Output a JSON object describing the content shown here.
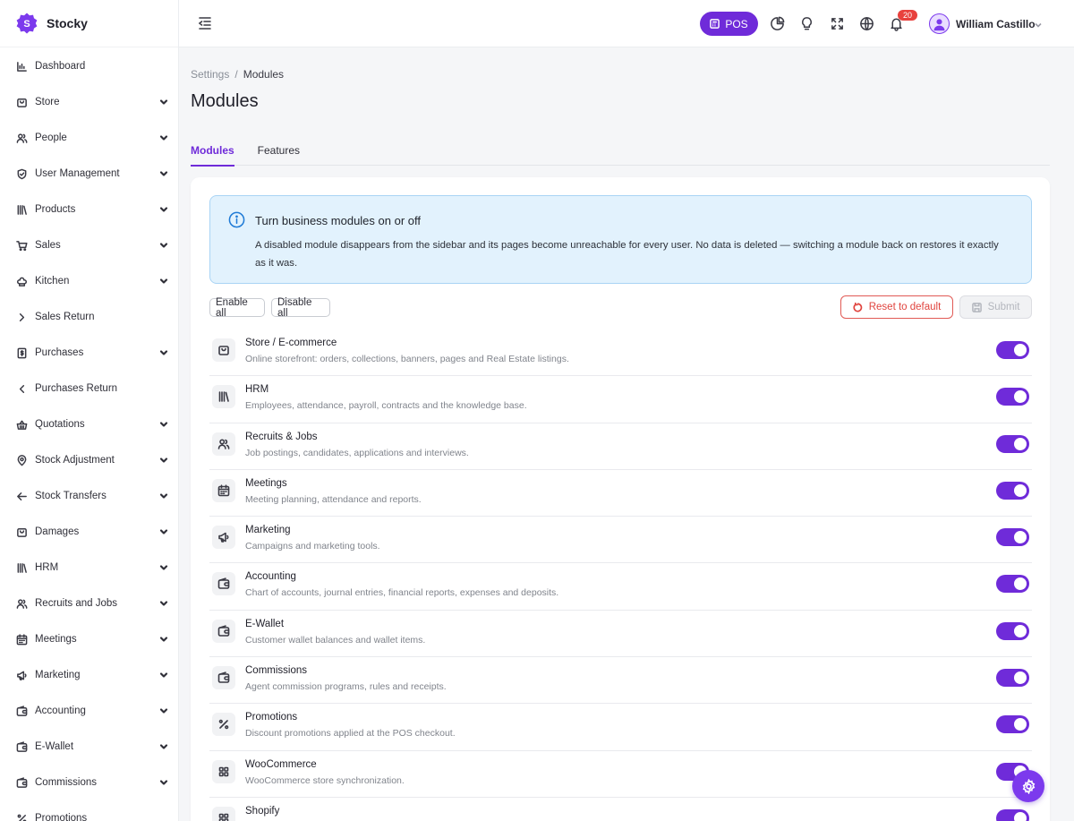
{
  "brand": {
    "name": "Stocky",
    "logo_letter": "S"
  },
  "sidebar": {
    "items": [
      {
        "label": "Dashboard",
        "icon": "chart-bar-icon",
        "chevron": "none"
      },
      {
        "label": "Store",
        "icon": "bag-icon",
        "chevron": "down"
      },
      {
        "label": "People",
        "icon": "users-icon",
        "chevron": "down"
      },
      {
        "label": "User Management",
        "icon": "shield-icon",
        "chevron": "down"
      },
      {
        "label": "Products",
        "icon": "library-icon",
        "chevron": "down"
      },
      {
        "label": "Sales",
        "icon": "cart-icon",
        "chevron": "down"
      },
      {
        "label": "Kitchen",
        "icon": "chef-hat-icon",
        "chevron": "down"
      },
      {
        "label": "Sales Return",
        "icon": "chevron-right-icon",
        "chevron": "none"
      },
      {
        "label": "Purchases",
        "icon": "invoice-icon",
        "chevron": "down"
      },
      {
        "label": "Purchases Return",
        "icon": "chevron-left-icon",
        "chevron": "none"
      },
      {
        "label": "Quotations",
        "icon": "basket-icon",
        "chevron": "down"
      },
      {
        "label": "Stock Adjustment",
        "icon": "map-pin-icon",
        "chevron": "down"
      },
      {
        "label": "Stock Transfers",
        "icon": "arrow-left-icon",
        "chevron": "down"
      },
      {
        "label": "Damages",
        "icon": "bag-icon",
        "chevron": "down"
      },
      {
        "label": "HRM",
        "icon": "library-icon",
        "chevron": "down"
      },
      {
        "label": "Recruits and Jobs",
        "icon": "users-icon",
        "chevron": "down"
      },
      {
        "label": "Meetings",
        "icon": "calendar-icon",
        "chevron": "down"
      },
      {
        "label": "Marketing",
        "icon": "megaphone-icon",
        "chevron": "down"
      },
      {
        "label": "Accounting",
        "icon": "wallet-icon",
        "chevron": "down"
      },
      {
        "label": "E-Wallet",
        "icon": "wallet-icon",
        "chevron": "down"
      },
      {
        "label": "Commissions",
        "icon": "wallet-icon",
        "chevron": "down"
      },
      {
        "label": "Promotions",
        "icon": "percent-icon",
        "chevron": "none"
      }
    ]
  },
  "header": {
    "pos_label": "POS",
    "notification_count": "20",
    "user_name": "William Castillo"
  },
  "breadcrumb": {
    "parent": "Settings",
    "separator": "/",
    "current": "Modules"
  },
  "page_title": "Modules",
  "tabs": [
    {
      "label": "Modules",
      "active": true
    },
    {
      "label": "Features",
      "active": false
    }
  ],
  "alert": {
    "title": "Turn business modules on or off",
    "text": "A disabled module disappears from the sidebar and its pages become unreachable for every user. No data is deleted — switching a module back on restores it exactly as it was."
  },
  "actions": {
    "enable_all": "Enable all",
    "disable_all": "Disable all",
    "reset": "Reset to default",
    "submit": "Submit"
  },
  "modules": [
    {
      "name": "Store / E-commerce",
      "desc": "Online storefront: orders, collections, banners, pages and Real Estate listings.",
      "icon": "bag-icon",
      "enabled": true
    },
    {
      "name": "HRM",
      "desc": "Employees, attendance, payroll, contracts and the knowledge base.",
      "icon": "library-icon",
      "enabled": true
    },
    {
      "name": "Recruits & Jobs",
      "desc": "Job postings, candidates, applications and interviews.",
      "icon": "users-icon",
      "enabled": true
    },
    {
      "name": "Meetings",
      "desc": "Meeting planning, attendance and reports.",
      "icon": "calendar-icon",
      "enabled": true
    },
    {
      "name": "Marketing",
      "desc": "Campaigns and marketing tools.",
      "icon": "megaphone-icon",
      "enabled": true
    },
    {
      "name": "Accounting",
      "desc": "Chart of accounts, journal entries, financial reports, expenses and deposits.",
      "icon": "wallet-icon",
      "enabled": true
    },
    {
      "name": "E-Wallet",
      "desc": "Customer wallet balances and wallet items.",
      "icon": "wallet-icon",
      "enabled": true
    },
    {
      "name": "Commissions",
      "desc": "Agent commission programs, rules and receipts.",
      "icon": "wallet-icon",
      "enabled": true
    },
    {
      "name": "Promotions",
      "desc": "Discount promotions applied at the POS checkout.",
      "icon": "percent-icon",
      "enabled": true
    },
    {
      "name": "WooCommerce",
      "desc": "WooCommerce store synchronization.",
      "icon": "grid-icon",
      "enabled": true
    },
    {
      "name": "Shopify",
      "desc": "",
      "icon": "grid-icon",
      "enabled": true
    }
  ],
  "colors": {
    "accent": "#6f2bd9",
    "danger": "#e0443e",
    "info_bg": "#e2f2fd",
    "info_border": "#a9d4f5"
  }
}
